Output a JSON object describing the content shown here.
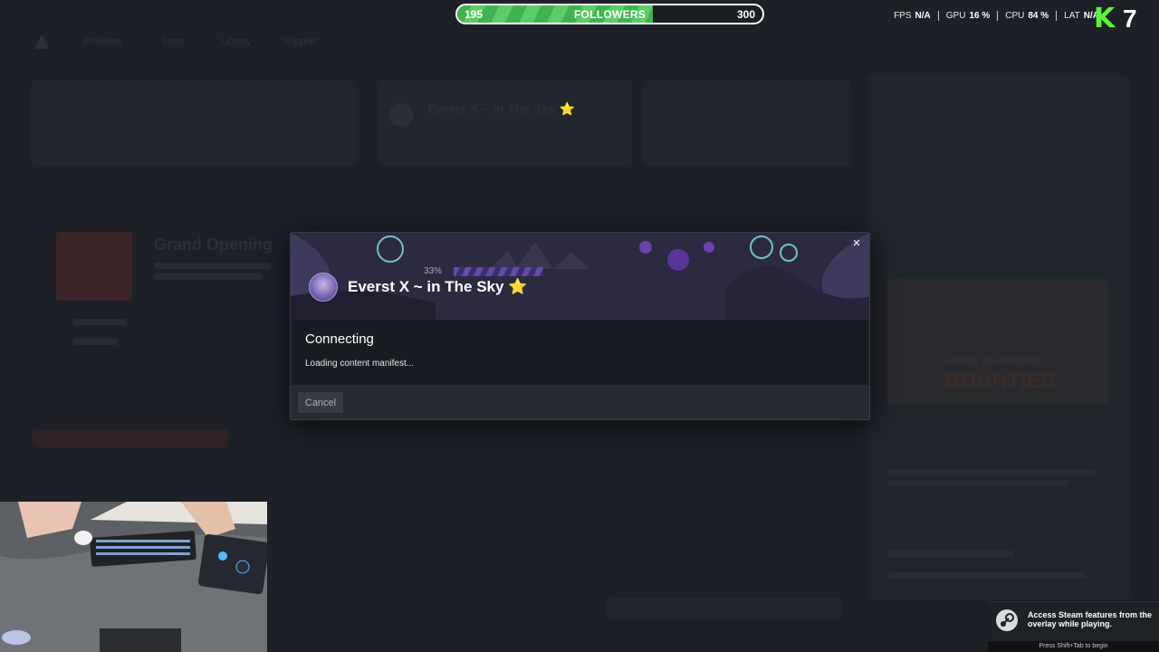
{
  "followers_bar": {
    "start": "195",
    "label": "FOLLOWERS",
    "goal": "300",
    "progress_fraction": 0.64,
    "fill_color": "#4cbf58"
  },
  "perf_overlay": {
    "items": [
      {
        "label": "FPS",
        "value": "N/A"
      },
      {
        "label": "GPU",
        "value": "16 %"
      },
      {
        "label": "CPU",
        "value": "84 %"
      },
      {
        "label": "LAT",
        "value": "N/A"
      }
    ],
    "logo_letter": "K",
    "logo_number": "7",
    "logo_color": "#58f53a"
  },
  "background_app": {
    "nav_links": [
      "Freebies",
      "Store",
      "Library",
      "Support"
    ],
    "card_title": "Everst X ~ in The Sky ⭐",
    "promo_title": "Grand Opening",
    "poster_text": "BOUNTIES",
    "poster_sub": "SURVIVE. BUILD. DEFEND"
  },
  "modal": {
    "game_title": "Everst X ~ in The Sky ⭐",
    "progress_percent_label": "33%",
    "progress_fraction": 0.33,
    "heading": "Connecting",
    "status": "Loading content manifest...",
    "cancel_label": "Cancel",
    "close_icon": "×",
    "accent_color": "#6a4fb5"
  },
  "steam_toast": {
    "message": "Access Steam features from the overlay while playing.",
    "hint": "Press Shift+Tab to begin"
  }
}
